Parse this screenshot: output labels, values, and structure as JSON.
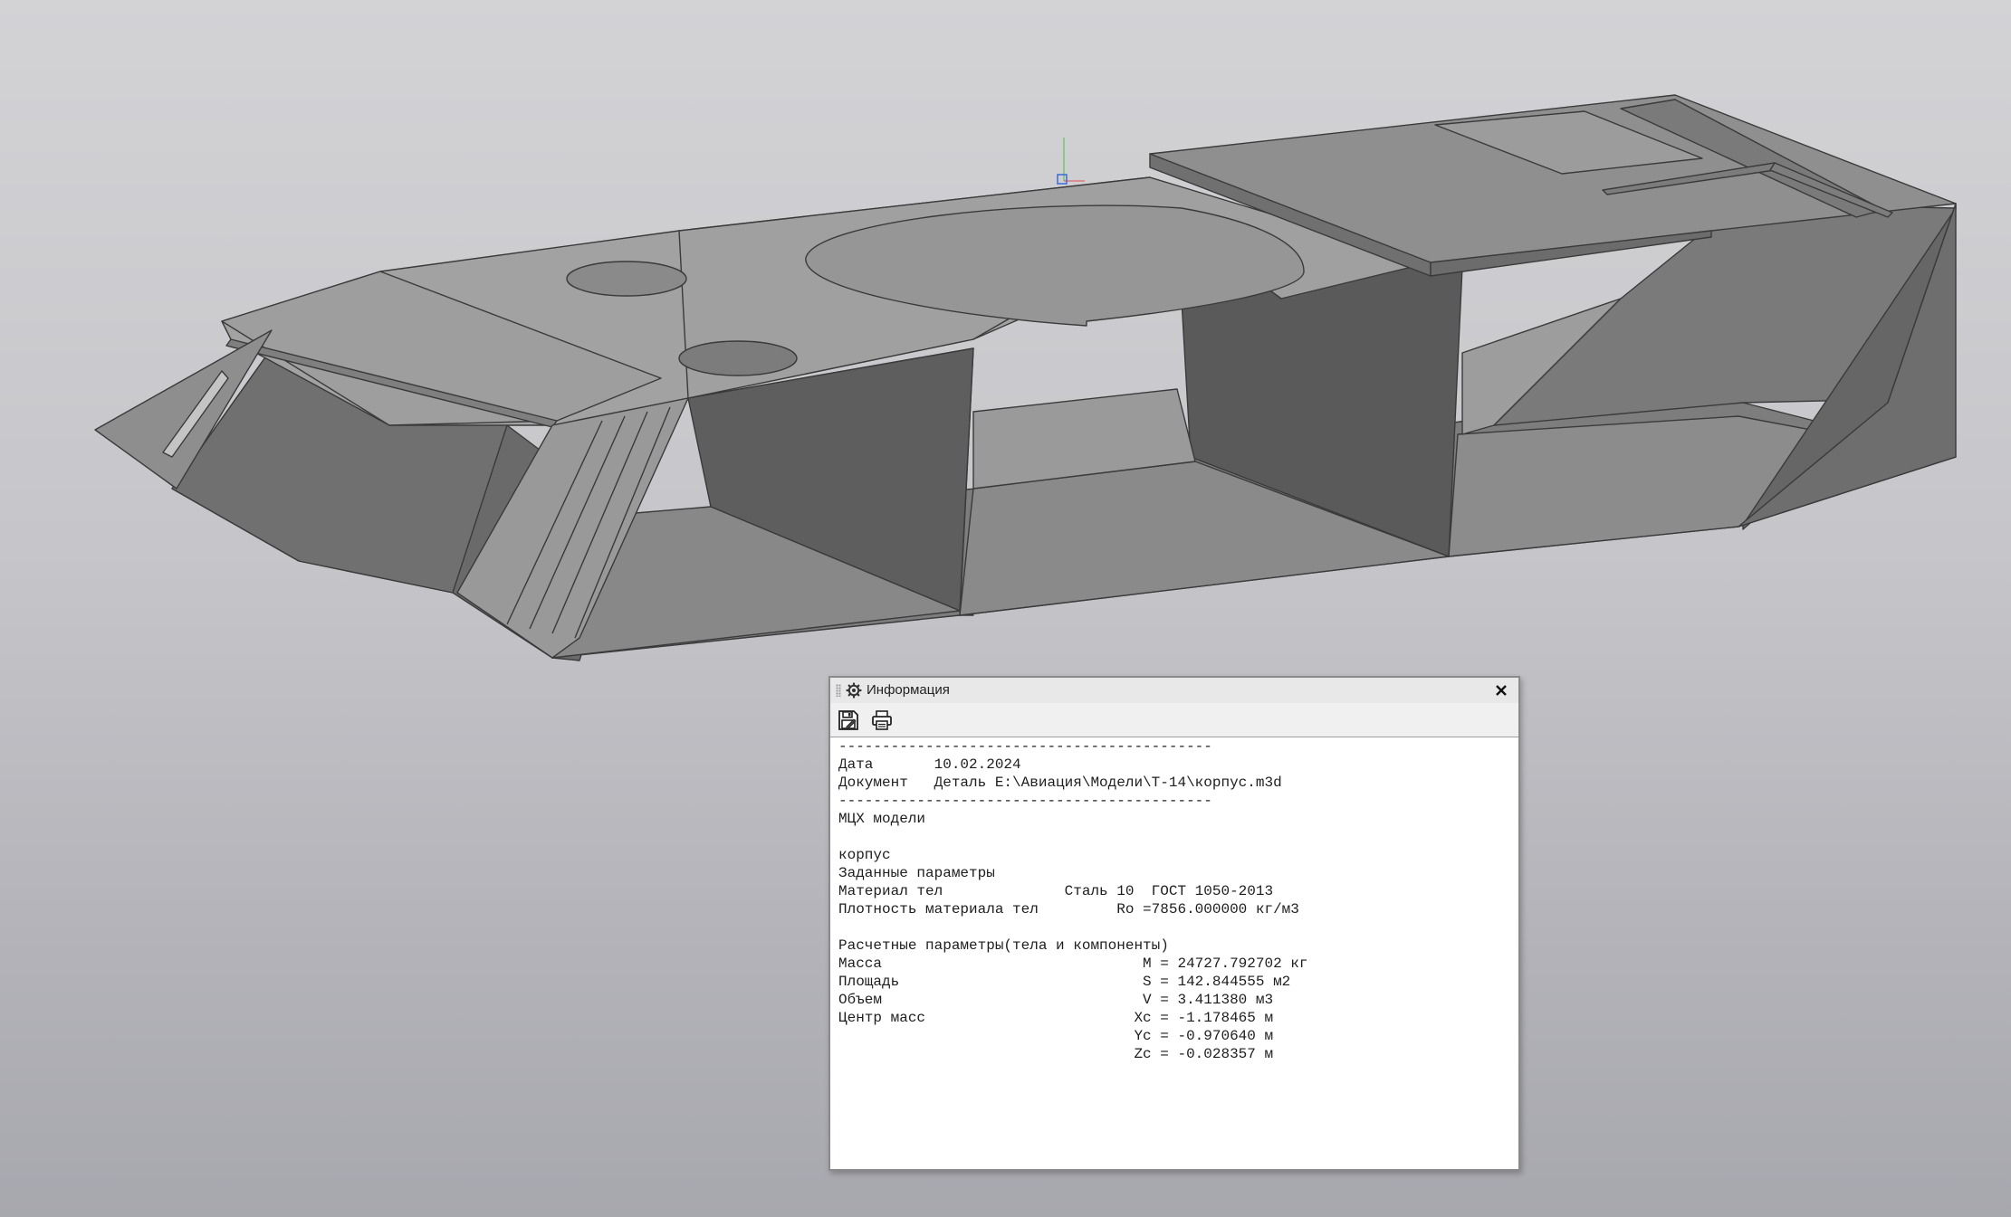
{
  "window": {
    "title": "Информация"
  },
  "icons": {
    "panel": "gear-icon",
    "close": "close-icon",
    "save": "save-icon",
    "print": "print-icon"
  },
  "colors": {
    "model_light": "#a3a3a3",
    "model_mid": "#8c8c8c",
    "model_dark": "#5f5f5f",
    "background_top": "#d3d3d6",
    "background_bottom": "#a7a7ae"
  },
  "report": {
    "separator_top": "-------------------------------------------",
    "date_line": "Дата       10.02.2024",
    "document_line": "Документ   Деталь E:\\Авиация\\Модели\\Т-14\\корпус.m3d",
    "separator_bottom": "-------------------------------------------",
    "heading": "МЦХ модели",
    "blank1": "",
    "part_name": "корпус",
    "given_params": "Заданные параметры",
    "material_line": "Материал тел              Сталь 10  ГОСТ 1050-2013",
    "density_line": "Плотность материала тел         Ro =7856.000000 кг/м3",
    "blank2": "",
    "calc_params": "Расчетные параметры(тела и компоненты)",
    "mass_line": "Масса                              M = 24727.792702 кг",
    "area_line": "Площадь                            S = 142.844555 м2",
    "volume_line": "Объем                              V = 3.411380 м3",
    "center_line": "Центр масс                        Xc = -1.178465 м",
    "yc_line": "                                  Yc = -0.970640 м",
    "zc_line": "                                  Zc = -0.028357 м"
  }
}
